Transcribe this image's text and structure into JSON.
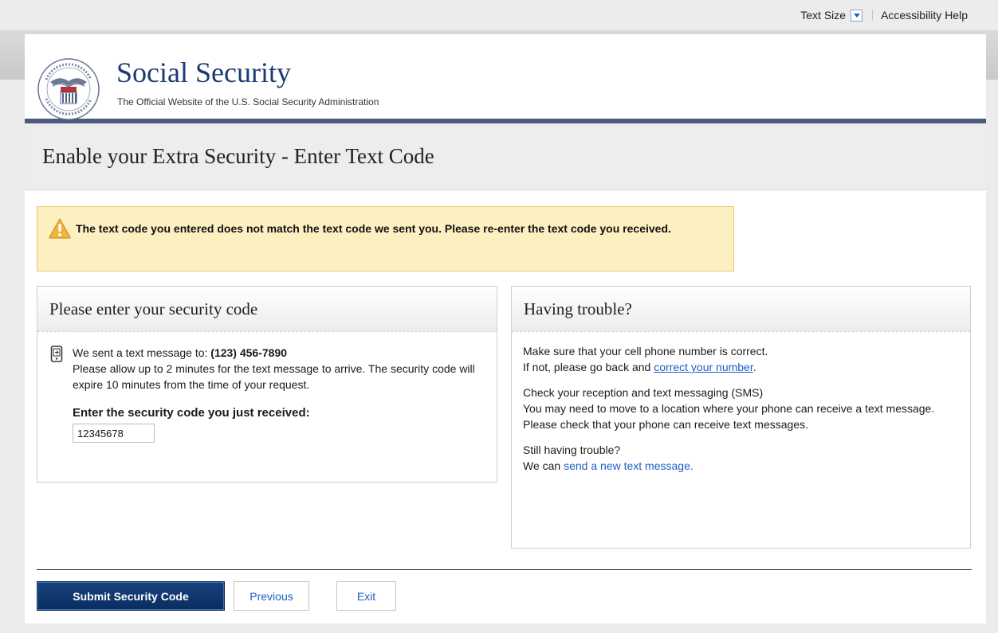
{
  "utility": {
    "text_size_label": "Text Size",
    "accessibility_label": "Accessibility Help"
  },
  "header": {
    "site_title": "Social Security",
    "site_subtitle": "The Official Website of the U.S. Social Security Administration",
    "seal_text": "SOCIAL SECURITY ADMINISTRATION USA"
  },
  "page": {
    "title": "Enable your Extra Security - Enter Text Code"
  },
  "alert": {
    "icon": "warning-icon",
    "message": "The text code you entered does not match the text code we sent you. Please re-enter the text code you received."
  },
  "code_panel": {
    "title": "Please enter your security code",
    "icon": "phone-icon",
    "sent_prefix": "We sent a text message to: ",
    "phone_number": "(123) 456-7890",
    "sent_detail": "Please allow up to 2 minutes for the text message to arrive. The security code will expire 10 minutes from the time of your request.",
    "input_label": "Enter the security code you just received:",
    "input_value": "12345678"
  },
  "trouble_panel": {
    "title": "Having trouble?",
    "para1_line1": "Make sure that your cell phone number is correct.",
    "para1_line2_prefix": "If not, please go back and ",
    "para1_link": "correct your number",
    "para1_suffix": ".",
    "para2_line1": "Check your reception and text messaging (SMS)",
    "para2_line2": "You may need to move to a location where your phone can receive a text message. Please check that your phone can receive text messages.",
    "para3_line1": "Still having trouble?",
    "para3_prefix": "We can ",
    "para3_link": "send a new text message."
  },
  "actions": {
    "submit_label": "Submit Security Code",
    "previous_label": "Previous",
    "exit_label": "Exit"
  },
  "colors": {
    "header_rule": "#4c5a7d",
    "brand_blue": "#1d3a70",
    "link_blue": "#1c5ec5",
    "alert_bg": "#fcefc0",
    "alert_border": "#e7c96b",
    "primary_button": "#0a2d5f"
  }
}
